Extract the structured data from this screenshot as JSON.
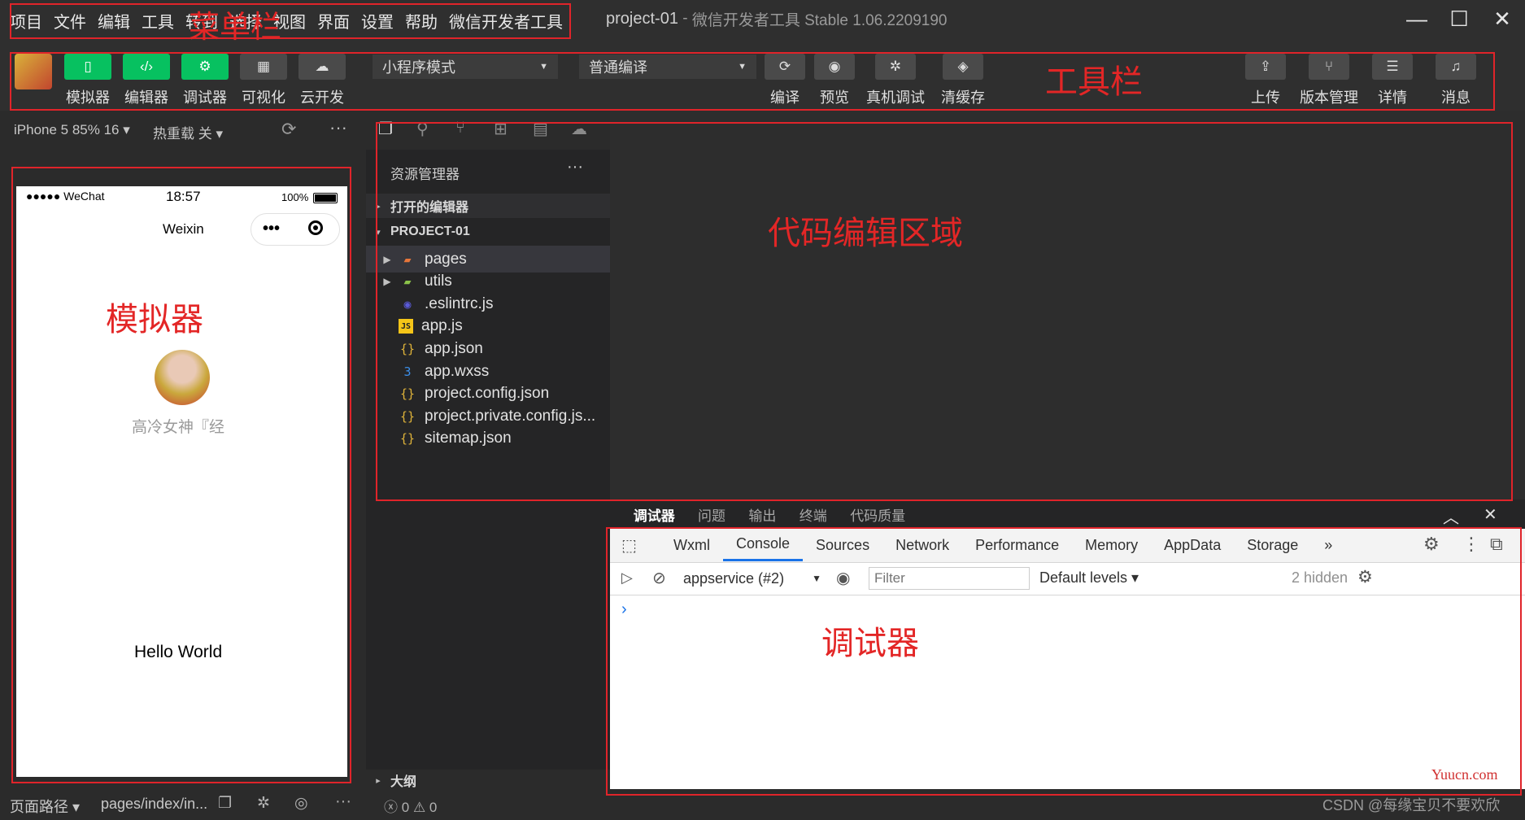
{
  "menu": [
    "项目",
    "文件",
    "编辑",
    "工具",
    "转到",
    "选择",
    "视图",
    "界面",
    "设置",
    "帮助",
    "微信开发者工具"
  ],
  "window": {
    "project": "project-01",
    "separator": " - ",
    "app_version": "微信开发者工具 Stable 1.06.2209190",
    "minimize": "—",
    "maximize": "☐",
    "close": "✕"
  },
  "toolbar": {
    "left_buttons": [
      "模拟器",
      "编辑器",
      "调试器",
      "可视化",
      "云开发"
    ],
    "mode_select": "小程序模式",
    "compile_select": "普通编译",
    "mid_buttons": [
      "编译",
      "预览",
      "真机调试",
      "清缓存"
    ],
    "right_buttons": [
      "上传",
      "版本管理",
      "详情",
      "消息"
    ]
  },
  "annotations": {
    "menubar": "菜单栏",
    "toolbar": "工具栏",
    "simulator": "模拟器",
    "editor": "代码编辑区域",
    "debugger": "调试器"
  },
  "simulator": {
    "device": "iPhone 5 85% 16",
    "hot_reload": "热重载 关",
    "signal": "●●●●● WeChat",
    "time": "18:57",
    "battery": "100%",
    "nav_title": "Weixin",
    "capsule_dots": "•••",
    "nickname": "高冷女神『经",
    "hello": "Hello World"
  },
  "explorer": {
    "title": "资源管理器",
    "more": "···",
    "open_editors": "打开的编辑器",
    "project": "PROJECT-01",
    "files": [
      {
        "name": "pages",
        "kind": "folder"
      },
      {
        "name": "utils",
        "kind": "folder"
      },
      {
        "name": ".eslintrc.js",
        "kind": "eslint"
      },
      {
        "name": "app.js",
        "kind": "js"
      },
      {
        "name": "app.json",
        "kind": "json"
      },
      {
        "name": "app.wxss",
        "kind": "css"
      },
      {
        "name": "project.config.json",
        "kind": "json"
      },
      {
        "name": "project.private.config.js...",
        "kind": "json"
      },
      {
        "name": "sitemap.json",
        "kind": "json"
      }
    ],
    "outline": "大纲"
  },
  "debugger": {
    "panel_tabs": [
      "调试器",
      "问题",
      "输出",
      "终端",
      "代码质量"
    ],
    "devtools_tabs": [
      "Wxml",
      "Console",
      "Sources",
      "Network",
      "Performance",
      "Memory",
      "AppData",
      "Storage"
    ],
    "active_tab": "Console",
    "more_tabs": "»",
    "context": "appservice (#2)",
    "filter_placeholder": "Filter",
    "levels": "Default levels ▾",
    "hidden": "2 hidden",
    "prompt": "›"
  },
  "statusbar": {
    "page_path_label": "页面路径",
    "page_path": "pages/index/in...",
    "errors": "0",
    "warnings": "0"
  },
  "watermarks": {
    "site": "Yuucn.com",
    "csdn": "CSDN @每缘宝贝不要欢欣"
  },
  "colors": {
    "accent_green": "#07c160",
    "annotation_red": "#e0242a",
    "devtools_blue": "#1a73e8"
  }
}
